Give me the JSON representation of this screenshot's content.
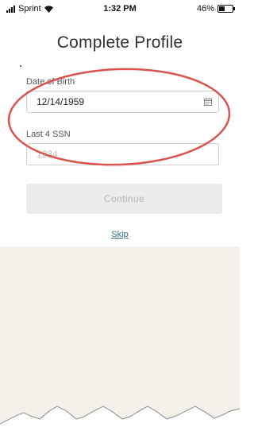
{
  "status_bar": {
    "carrier": "Sprint",
    "time": "1:32 PM",
    "battery_percent": "46%",
    "battery_level": 0.46
  },
  "page": {
    "title": "Complete Profile"
  },
  "form": {
    "dob_label": "Date of Birth",
    "dob_value": "12/14/1959",
    "ssn_label": "Last 4 SSN",
    "ssn_placeholder": "1234",
    "continue_label": "Continue",
    "skip_label": "Skip"
  },
  "annotation": {
    "color": "#d9534f"
  },
  "colors": {
    "link": "#2f6f86",
    "disabled_button_bg": "#ececec",
    "lower_background": "#f3f1ea"
  }
}
